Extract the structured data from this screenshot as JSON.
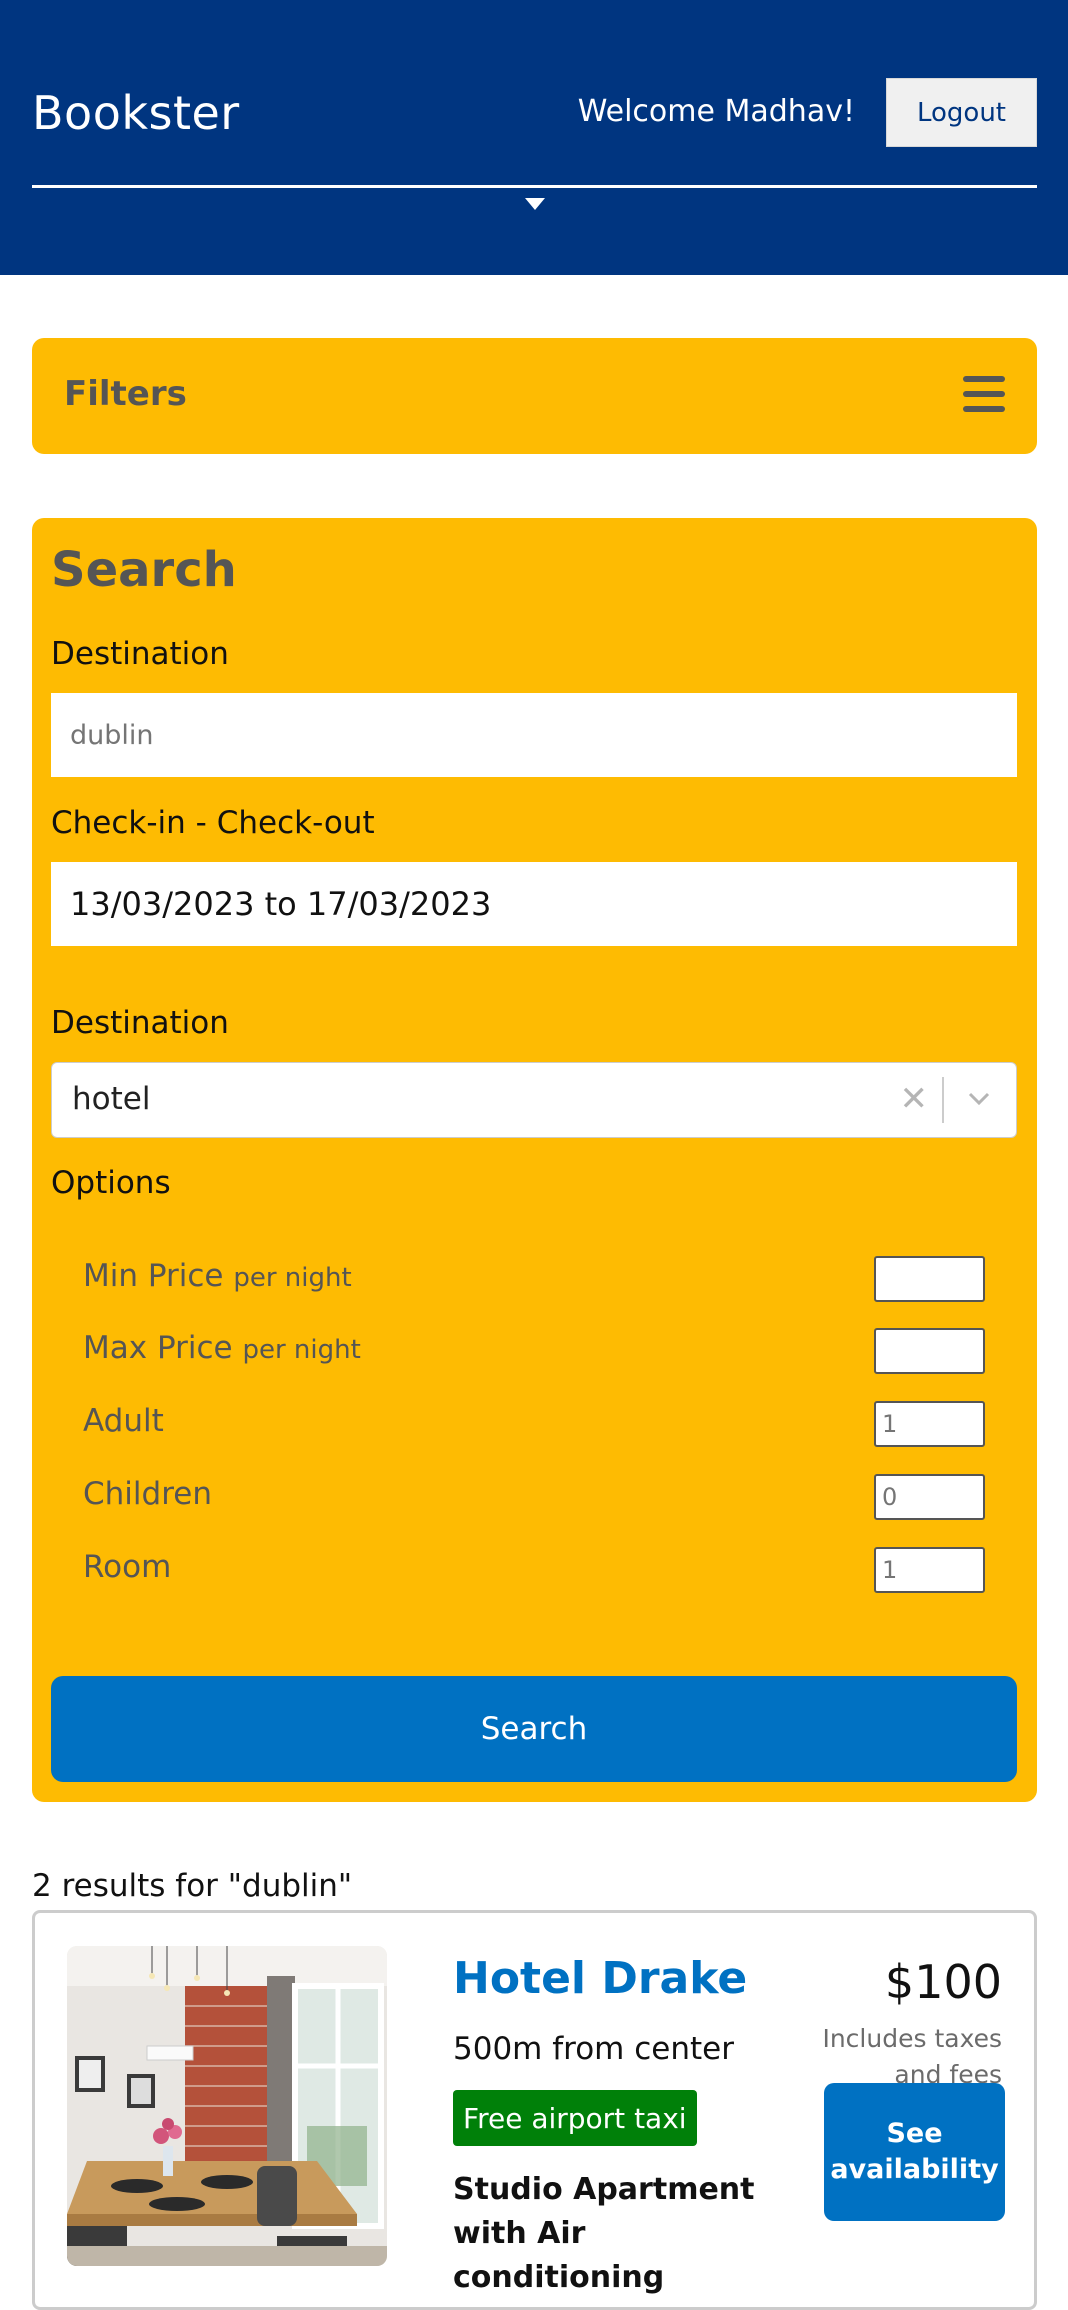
{
  "header": {
    "brand": "Bookster",
    "welcome": "Welcome Madhav!",
    "logout_label": "Logout"
  },
  "filters": {
    "title": "Filters"
  },
  "search": {
    "title": "Search",
    "destination_label": "Destination",
    "destination_placeholder": "dublin",
    "dates_label": "Check-in - Check-out",
    "dates_value": "13/03/2023 to 17/03/2023",
    "type_label": "Destination",
    "type_value": "hotel",
    "options_label": "Options",
    "options": {
      "min_price_label": "Min Price",
      "min_price_unit": "per night",
      "max_price_label": "Max Price",
      "max_price_unit": "per night",
      "adult_label": "Adult",
      "adult_value": "1",
      "children_label": "Children",
      "children_value": "0",
      "room_label": "Room",
      "room_value": "1"
    },
    "button_label": "Search"
  },
  "results": {
    "count_text": "2 results for \"dublin\"",
    "items": [
      {
        "name": "Hotel Drake",
        "distance": "500m from center",
        "badge": "Free airport taxi",
        "room_type": "Studio Apartment with Air conditioning",
        "price": "$100",
        "taxes_note": "Includes taxes and fees",
        "availability_label": "See availability"
      }
    ]
  },
  "colors": {
    "header_bg": "#003580",
    "panel_bg": "#febb02",
    "primary_button": "#0071c2",
    "badge_green": "#008009"
  }
}
